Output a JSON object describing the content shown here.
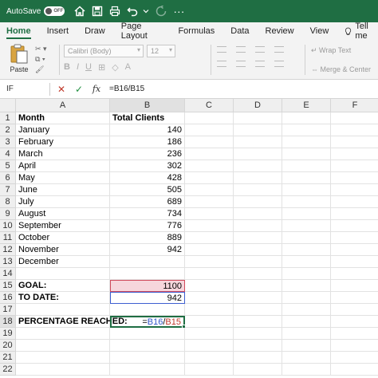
{
  "titlebar": {
    "autosave_label": "AutoSave",
    "autosave_state": "OFF",
    "icons": [
      "home-icon",
      "save-icon",
      "print-icon",
      "undo-icon",
      "redo-icon",
      "more-icon"
    ]
  },
  "tabs": [
    "Home",
    "Insert",
    "Draw",
    "Page Layout",
    "Formulas",
    "Data",
    "Review",
    "View"
  ],
  "active_tab": "Home",
  "tell_me": "Tell me",
  "ribbon": {
    "paste_label": "Paste",
    "font_name": "Calibri (Body)",
    "font_size": "12",
    "wrap_text": "Wrap Text",
    "merge_center": "Merge & Center"
  },
  "formula_bar": {
    "name_box": "IF",
    "formula": "=B16/B15"
  },
  "columns": [
    "A",
    "B",
    "C",
    "D",
    "E",
    "F"
  ],
  "rows": [
    {
      "n": "1",
      "a": "Month",
      "b": "Total Clients"
    },
    {
      "n": "2",
      "a": "January",
      "b": "140"
    },
    {
      "n": "3",
      "a": "February",
      "b": "186"
    },
    {
      "n": "4",
      "a": "March",
      "b": "236"
    },
    {
      "n": "5",
      "a": "April",
      "b": "302"
    },
    {
      "n": "6",
      "a": "May",
      "b": "428"
    },
    {
      "n": "7",
      "a": "June",
      "b": "505"
    },
    {
      "n": "8",
      "a": "July",
      "b": "689"
    },
    {
      "n": "9",
      "a": "August",
      "b": "734"
    },
    {
      "n": "10",
      "a": "September",
      "b": "776"
    },
    {
      "n": "11",
      "a": "October",
      "b": "889"
    },
    {
      "n": "12",
      "a": "November",
      "b": "942"
    },
    {
      "n": "13",
      "a": "December",
      "b": ""
    },
    {
      "n": "14",
      "a": "",
      "b": ""
    },
    {
      "n": "15",
      "a": "GOAL:",
      "b": "1100"
    },
    {
      "n": "16",
      "a": "TO DATE:",
      "b": "942"
    },
    {
      "n": "17",
      "a": "",
      "b": ""
    },
    {
      "n": "18",
      "a": "PERCENTAGE REACHED:",
      "b": ""
    },
    {
      "n": "19",
      "a": "",
      "b": ""
    },
    {
      "n": "20",
      "a": "",
      "b": ""
    },
    {
      "n": "21",
      "a": "",
      "b": ""
    },
    {
      "n": "22",
      "a": "",
      "b": ""
    }
  ],
  "active_cell_formula": {
    "prefix": "=",
    "ref1": "B16",
    "slash": "/",
    "ref2": "B15"
  },
  "colors": {
    "accent": "#1f6e43",
    "goal_highlight": "#f6d6dc",
    "ref_blue": "#2f56c8",
    "ref_red": "#c0392b"
  }
}
